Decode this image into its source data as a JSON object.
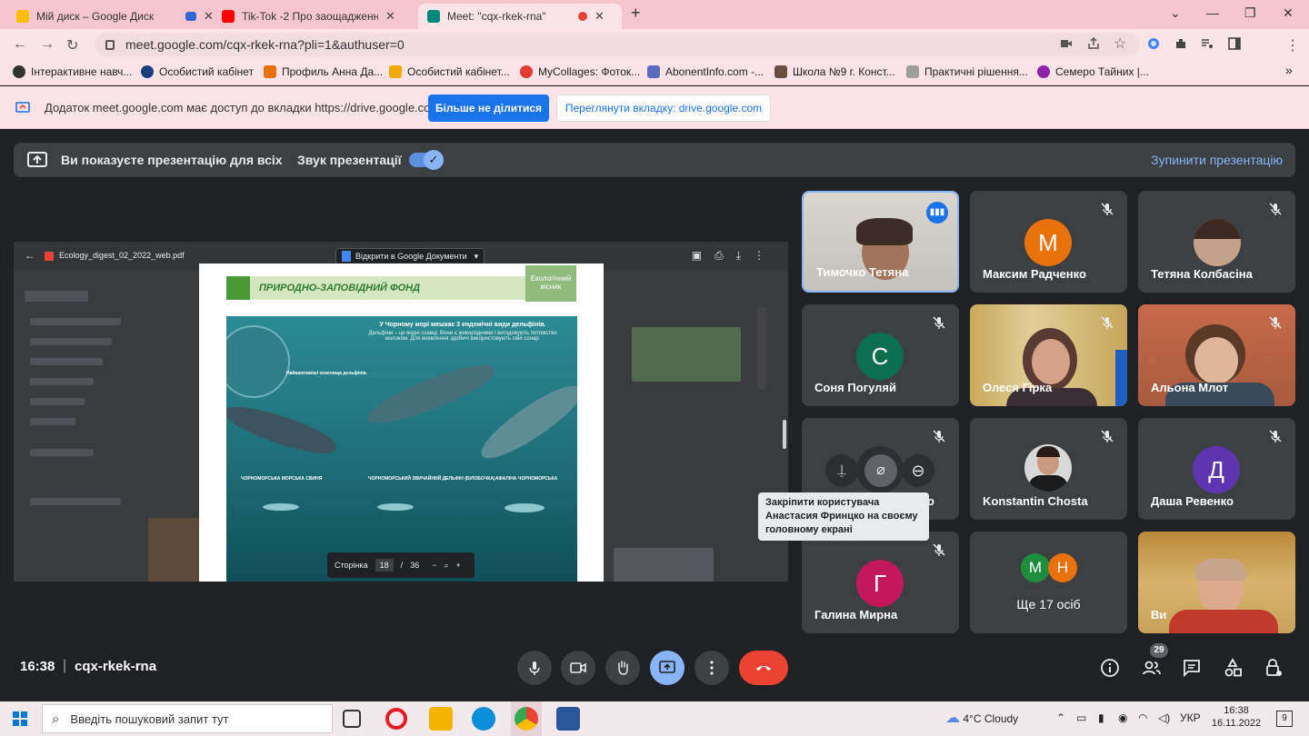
{
  "browser": {
    "tabs": [
      {
        "title": "Мій диск – Google Диск",
        "favicon_color": "#fbbc04"
      },
      {
        "title": "Tik-Tok -2 Про заощадження ен",
        "favicon_color": "#ff0000"
      },
      {
        "title": "Meet: \"cqx-rkek-rna\"",
        "favicon_color": "#00897b"
      }
    ],
    "new_tab": "+",
    "url": "meet.google.com/cqx-rkek-rna?pli=1&authuser=0",
    "bookmarks": [
      "Інтерактивне навч...",
      "Особистий кабінет",
      "Профиль Анна Да...",
      "Особистий кабінет...",
      "MyCollages: Фоток...",
      "AbonentInfo.com -...",
      "Школа №9 г. Конст...",
      "Практичні рішення...",
      "Семеро Тайних |..."
    ],
    "bookmarks_more": "»"
  },
  "infobar": {
    "message": "Додаток meet.google.com має доступ до вкладки https://drive.google.com",
    "stop_sharing": "Більше не ділитися",
    "view_tab": "Переглянути вкладку: drive.google.com"
  },
  "banner": {
    "presenting": "Ви показуєте презентацію для всіх",
    "audio": "Звук презентації",
    "audio_on": true,
    "stop": "Зупинити презентацію"
  },
  "presentation": {
    "filename": "Ecology_digest_02_2022_web.pdf",
    "open_in": "Відкрити в Google Документи",
    "page_header": "ПРИРОДНО-ЗАПОВІДНИЙ ФОНД",
    "logo_text": "Екологічний вісник",
    "info_title": "У Чорному морі мешкає 3 ендемічні види дельфінів.",
    "info_sub": "Дельфіни – це водні ссавці. Вони є живородними і вигодовують потомство молоком. Для виявлення здобичі використовують свій сонар.",
    "info_small_title": "Найважливіші осколища дельфінів.",
    "species": [
      "ЧОРНОМОРСЬКА МОРСЬКА СВИНЯ",
      "ЧОРНОМОРСЬКИЙ ЗВИЧАЙНИЙ ДЕЛЬФІН (БІЛОБОЧКА)",
      "АФАЛІНА ЧОРНОМОРСЬКА"
    ],
    "page_label": "Сторінка",
    "page_current": "18",
    "page_sep": "/",
    "page_total": "36",
    "zoom_out": "−",
    "zoom_in": "+"
  },
  "participants": [
    {
      "name": "Тимочко Тетяна",
      "type": "video",
      "speaking": true
    },
    {
      "name": "Максим Радченко",
      "type": "avatar",
      "initial": "М",
      "color": "#e8710a"
    },
    {
      "name": "Тетяна Колбасіна",
      "type": "photo"
    },
    {
      "name": "Соня Погуляй",
      "type": "avatar",
      "initial": "С",
      "color": "#0b6e4f"
    },
    {
      "name": "Олеся Гірка",
      "type": "video"
    },
    {
      "name": "Альона Млот",
      "type": "video"
    },
    {
      "name": "Анастасия Фринцко",
      "type": "hover",
      "visible_suffix": "о"
    },
    {
      "name": "Konstantin Chosta",
      "type": "photo"
    },
    {
      "name": "Даша Ревенко",
      "type": "avatar",
      "initial": "Д",
      "color": "#5e35b1"
    },
    {
      "name": "Галина Мирна",
      "type": "avatar",
      "initial": "Г",
      "color": "#c2185b"
    },
    {
      "name": "Ще 17 осіб",
      "type": "more",
      "initials": [
        "М",
        "Н"
      ],
      "colors": [
        "#1e8e3e",
        "#e8710a"
      ]
    },
    {
      "name": "Ви",
      "type": "video"
    }
  ],
  "tooltip": "Закріпити користувача Анастасия Фринцко на своєму головному екрані",
  "bottom": {
    "time": "16:38",
    "separator": "|",
    "meeting_code": "cqx-rkek-rna",
    "participant_count": "29"
  },
  "taskbar": {
    "search_placeholder": "Введіть пошуковий запит тут",
    "weather": "4°C  Cloudy",
    "lang": "УКР",
    "time": "16:38",
    "date": "16.11.2022",
    "notifications": "9"
  }
}
